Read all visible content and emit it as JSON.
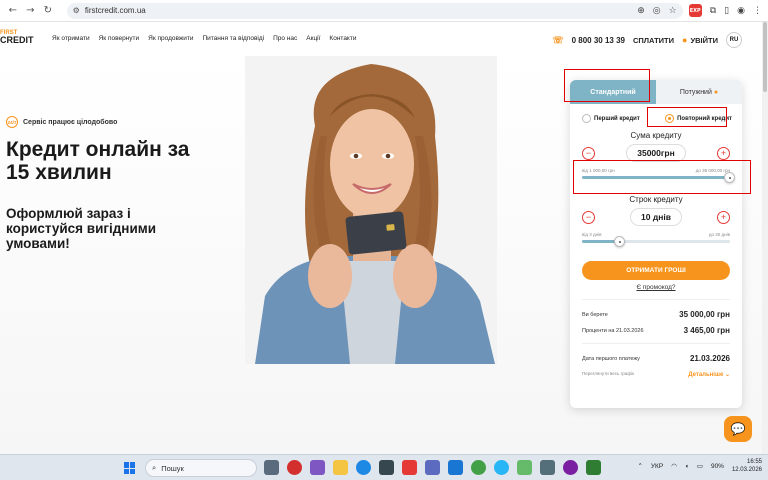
{
  "browser": {
    "url": "firstcredit.com.ua"
  },
  "header": {
    "logo_top": "FIRST",
    "logo_bottom": "CREDIT",
    "menu": [
      "Як отримати",
      "Як повернути",
      "Як продовжити",
      "Питання та відповіді",
      "Про нас",
      "Акції",
      "Контакти"
    ],
    "phone": "0 800 30 13 39",
    "pay": "СПЛАТИТИ",
    "login": "УВІЙТИ",
    "lang": "RU"
  },
  "hero": {
    "badge_icon_text": "24/7",
    "badge": "Сервіс працює цілодобово",
    "headline": "Кредит онлайн за 15 хвилин",
    "subline": "Оформлюй зараз і користуйся вигідними умовами!"
  },
  "calculator": {
    "tab_standard": "Стандартний",
    "tab_powerful": "Потужний",
    "radio_first": "Перший кредит",
    "radio_repeat": "Повторний кредит",
    "amount_title": "Сума кредиту",
    "amount_value": "35000грн",
    "amount_min": "від 1 000,00 грн",
    "amount_max": "до 35 000,00 грн",
    "amount_fraction": 1.0,
    "term_title": "Строк кредиту",
    "term_value": "10 днів",
    "term_min": "від 3 днів",
    "term_max": "до 30 днів",
    "term_fraction": 0.26,
    "cta": "ОТРИМАТИ ГРОШІ",
    "promo": "Є промокод?",
    "borrow_label": "Ви берете",
    "borrow_value": "35 000,00 грн",
    "interest_label": "Проценти на 21.03.2026",
    "interest_value": "3 465,00 грн",
    "payment_date_label": "Дата першого платежу",
    "payment_date_value": "21.03.2026",
    "schedule_link": "Переглянути весь графік",
    "details": "Детальніше"
  },
  "taskbar": {
    "search": "Пошук",
    "lang": "УКР",
    "battery": "90%",
    "time": "16:55",
    "date": "12.03.2026"
  },
  "colors": {
    "accent": "#f7941d",
    "tab_active": "#7fb3c6",
    "annotation": "#e00000"
  }
}
